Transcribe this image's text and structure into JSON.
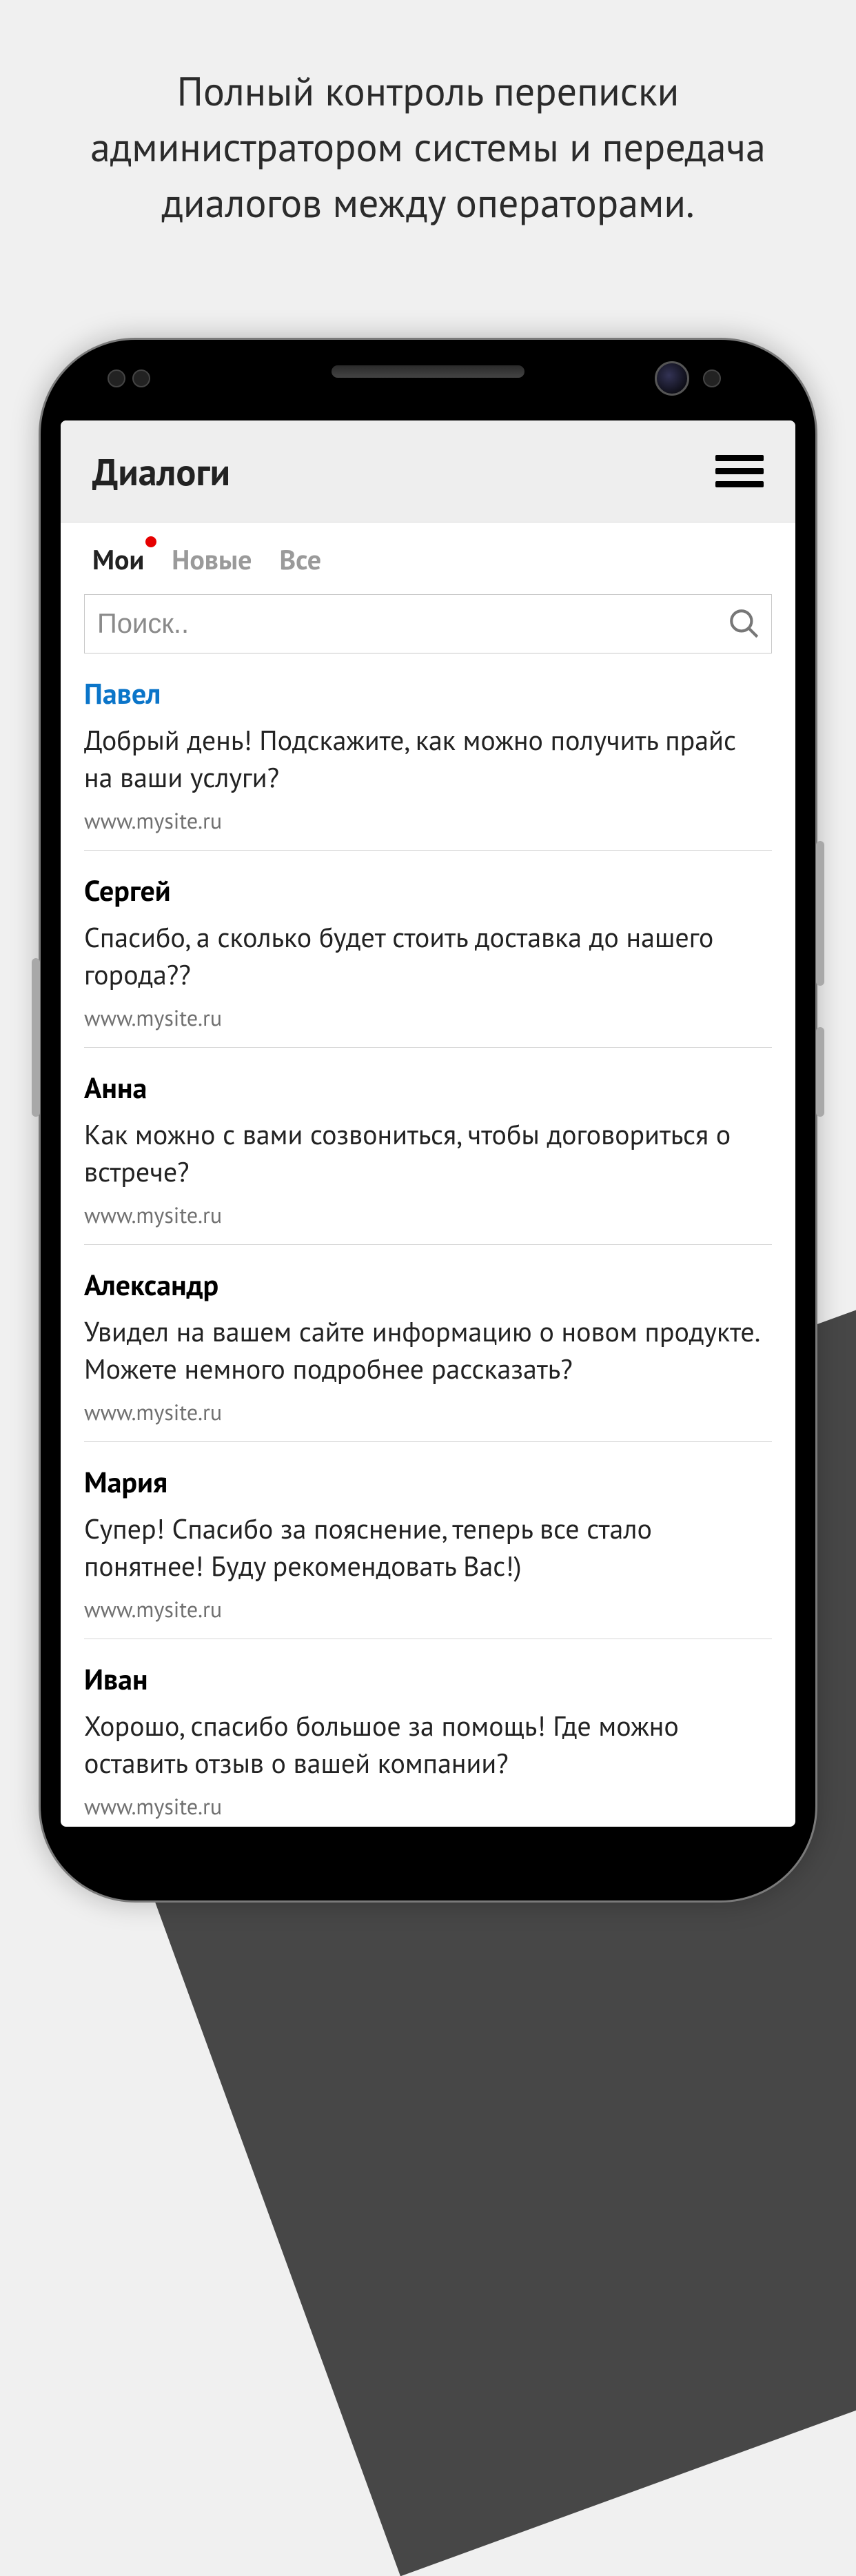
{
  "marketing_caption": "Полный контроль переписки администратором системы и передача диалогов между операторами.",
  "header": {
    "title": "Диалоги"
  },
  "tabs": {
    "my": "Мои",
    "new": "Новые",
    "all": "Все",
    "active": "my",
    "has_badge": true
  },
  "search": {
    "placeholder": "Поиск.."
  },
  "dialogs": [
    {
      "name": "Павел",
      "highlighted": true,
      "message": "Добрый день! Подскажите, как можно получить прайс на ваши услуги?",
      "site": "www.mysite.ru"
    },
    {
      "name": "Сергей",
      "highlighted": false,
      "message": "Спасибо, а сколько будет стоить доставка до нашего города??",
      "site": "www.mysite.ru"
    },
    {
      "name": "Анна",
      "highlighted": false,
      "message": "Как можно с вами созвониться, чтобы договориться о встрече?",
      "site": "www.mysite.ru"
    },
    {
      "name": "Александр",
      "highlighted": false,
      "message": "Увидел на вашем сайте информацию о новом продукте. Можете немного подробнее рассказать?",
      "site": "www.mysite.ru"
    },
    {
      "name": "Мария",
      "highlighted": false,
      "message": "Супер! Спасибо за пояснение, теперь все стало понятнее! Буду рекомендовать Вас!)",
      "site": "www.mysite.ru"
    },
    {
      "name": "Иван",
      "highlighted": false,
      "message": "Хорошо, спасибо большое за помощь! Где можно оставить отзыв о вашей компании?",
      "site": "www.mysite.ru"
    }
  ]
}
